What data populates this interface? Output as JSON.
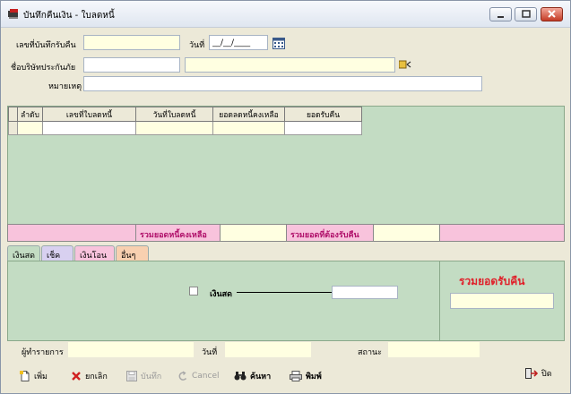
{
  "window": {
    "title": "บันทึกคืนเงิน - ใบลดหนี้"
  },
  "header": {
    "doc_no_label": "เลขที่บันทึกรับคืน",
    "doc_no_value": "",
    "date_label": "วันที่",
    "date_value": "__/__/____",
    "insurer_label": "ชื่อบริษัทประกันภัย",
    "insurer_code": "",
    "insurer_name": "",
    "note_label": "หมายเหตุ",
    "note_value": ""
  },
  "grid": {
    "columns": [
      "ลำดับ",
      "เลขที่ใบลดหนี้",
      "วันที่ใบลดหนี้",
      "ยอดลดหนี้คงเหลือ",
      "ยอดรับคืน"
    ]
  },
  "summary": {
    "remaining_label": "รวมยอดหนี้คงเหลือ",
    "remaining_value": "",
    "refund_label": "รวมยอดที่ต้องรับคืน",
    "refund_value": ""
  },
  "tabs": [
    "เงินสด",
    "เช็ค",
    "เงินโอน",
    "อื่นๆ"
  ],
  "cash_tab": {
    "checkbox_label": "เงินสด",
    "amount_value": "",
    "total_label": "รวมยอดรับคืน",
    "total_value": ""
  },
  "footer": {
    "operator_label": "ผู้ทำรายการ",
    "operator_value": "",
    "date_label": "วันที่",
    "date_value": "",
    "status_label": "สถานะ",
    "status_value": ""
  },
  "toolbar": {
    "add_label": "เพิ่ม",
    "cancel_doc_label": "ยกเลิก",
    "save_label": "บันทึก",
    "cancel_label": "Cancel",
    "search_label": "ค้นหา",
    "print_label": "พิมพ์",
    "close_label": "ปิด"
  },
  "colors": {
    "grid_bg": "#c3dcc3",
    "summary_bg": "#f8c3dc",
    "accent_red": "#e0202a"
  }
}
